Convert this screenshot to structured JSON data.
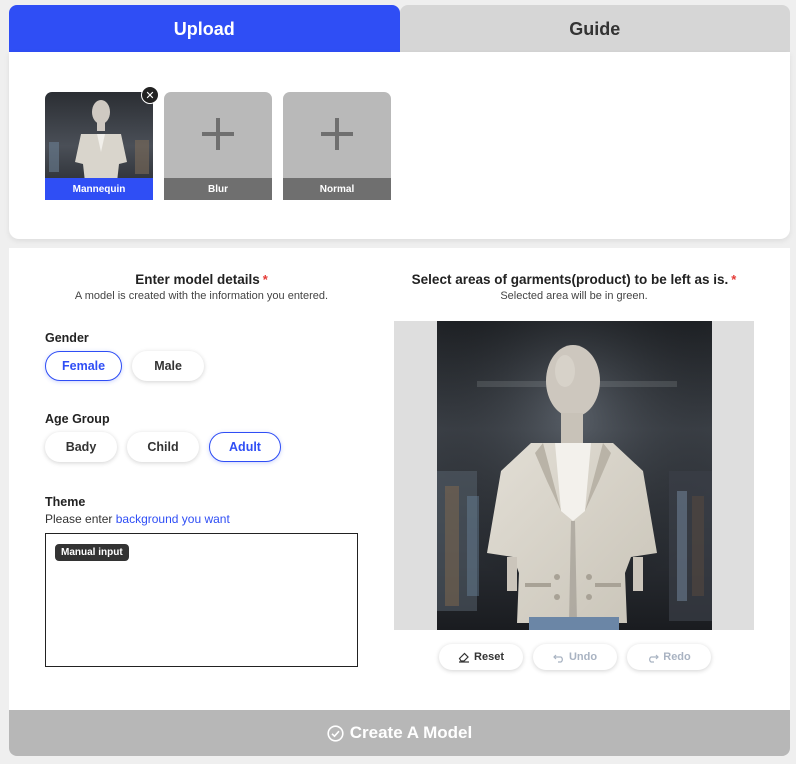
{
  "tabs": [
    {
      "label": "Upload",
      "active": true
    },
    {
      "label": "Guide",
      "active": false
    }
  ],
  "upload_slots": [
    {
      "label": "Mannequin",
      "filled": true
    },
    {
      "label": "Blur",
      "filled": false
    },
    {
      "label": "Normal",
      "filled": false
    }
  ],
  "model_details": {
    "title": "Enter model details",
    "required_mark": "*",
    "subtitle": "A model is created with the information you entered."
  },
  "gender": {
    "label": "Gender",
    "options": [
      "Female",
      "Male"
    ],
    "selected": "Female"
  },
  "age_group": {
    "label": "Age Group",
    "options": [
      "Bady",
      "Child",
      "Adult"
    ],
    "selected": "Adult"
  },
  "theme": {
    "label": "Theme",
    "hint_prefix": "Please enter ",
    "hint_link": "background you want",
    "chip": "Manual input",
    "value": ""
  },
  "garment_select": {
    "title": "Select areas of garments(product) to be left as is.",
    "required_mark": "*",
    "subtitle": "Selected area will be in green."
  },
  "tools": {
    "reset": "Reset",
    "undo": "Undo",
    "redo": "Redo"
  },
  "create_button": {
    "label": "Create A Model"
  },
  "colors": {
    "accent": "#2f4ef5",
    "disabled": "#b7b7b7",
    "required": "#e53935"
  }
}
